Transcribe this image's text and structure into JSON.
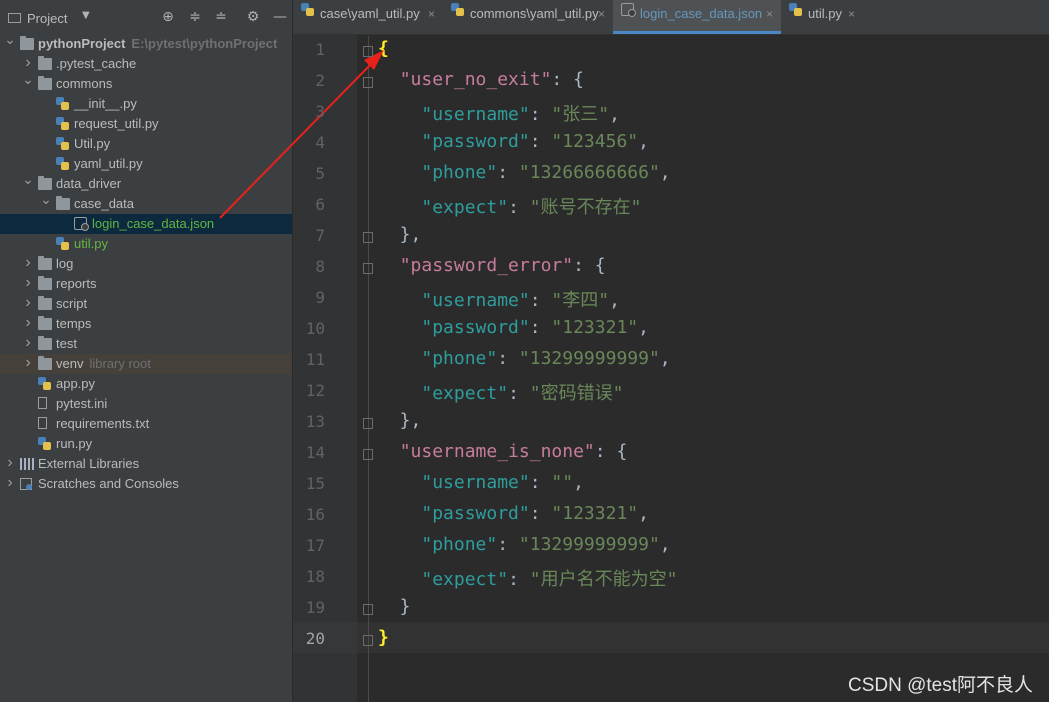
{
  "sidebar": {
    "title": "Project",
    "tree": [
      {
        "label": "pythonProject",
        "hint": "E:\\pytest\\pythonProject",
        "type": "folder",
        "expanded": true,
        "depth": 0,
        "bold": true
      },
      {
        "label": ".pytest_cache",
        "type": "folder",
        "expanded": false,
        "depth": 1
      },
      {
        "label": "commons",
        "type": "folder",
        "expanded": true,
        "depth": 1
      },
      {
        "label": "__init__.py",
        "type": "py",
        "depth": 2
      },
      {
        "label": "request_util.py",
        "type": "py",
        "depth": 2
      },
      {
        "label": "Util.py",
        "type": "py",
        "depth": 2
      },
      {
        "label": "yaml_util.py",
        "type": "py",
        "depth": 2
      },
      {
        "label": "data_driver",
        "type": "folder",
        "expanded": true,
        "depth": 1
      },
      {
        "label": "case_data",
        "type": "folder",
        "expanded": true,
        "depth": 2
      },
      {
        "label": "login_case_data.json",
        "type": "json",
        "depth": 3,
        "selected": true,
        "color": "#62b543"
      },
      {
        "label": "util.py",
        "type": "py",
        "depth": 2,
        "color": "#62b543"
      },
      {
        "label": "log",
        "type": "folder",
        "expanded": false,
        "depth": 1
      },
      {
        "label": "reports",
        "type": "folder",
        "expanded": false,
        "depth": 1
      },
      {
        "label": "script",
        "type": "folder",
        "expanded": false,
        "depth": 1
      },
      {
        "label": "temps",
        "type": "folder",
        "expanded": false,
        "depth": 1
      },
      {
        "label": "test",
        "type": "folder",
        "expanded": false,
        "depth": 1
      },
      {
        "label": "venv",
        "hint": "library root",
        "type": "folder",
        "expanded": false,
        "depth": 1,
        "venv": true
      },
      {
        "label": "app.py",
        "type": "py",
        "depth": 1
      },
      {
        "label": "pytest.ini",
        "type": "txt",
        "depth": 1
      },
      {
        "label": "requirements.txt",
        "type": "txt",
        "depth": 1
      },
      {
        "label": "run.py",
        "type": "py",
        "depth": 1
      },
      {
        "label": "External Libraries",
        "type": "lib",
        "expanded": false,
        "depth": 0
      },
      {
        "label": "Scratches and Consoles",
        "type": "scratch",
        "expanded": false,
        "depth": 0
      }
    ]
  },
  "tabs": [
    {
      "label": "case\\yaml_util.py",
      "icon": "python-file-icon"
    },
    {
      "label": "commons\\yaml_util.py",
      "icon": "python-file-icon"
    },
    {
      "label": "login_case_data.json",
      "icon": "json-file-icon",
      "active": true
    },
    {
      "label": "util.py",
      "icon": "python-file-icon"
    }
  ],
  "editor": {
    "current_line": 20,
    "lines": [
      "{",
      "  \"user_no_exit\": {",
      "    \"username\": \"张三\",",
      "    \"password\": \"123456\",",
      "    \"phone\": \"13266666666\",",
      "    \"expect\": \"账号不存在\"",
      "  },",
      "  \"password_error\": {",
      "    \"username\": \"李四\",",
      "    \"password\": \"123321\",",
      "    \"phone\": \"13299999999\",",
      "    \"expect\": \"密码错误\"",
      "  },",
      "  \"username_is_none\": {",
      "    \"username\": \"\",",
      "    \"password\": \"123321\",",
      "    \"phone\": \"13299999999\",",
      "    \"expect\": \"用户名不能为空\"",
      "  }",
      "}"
    ]
  },
  "watermark": "CSDN @test阿不良人",
  "colors": {
    "accent": "#4a88c7",
    "selection": "#0d293e",
    "annotation_arrow": "#e8221b"
  }
}
